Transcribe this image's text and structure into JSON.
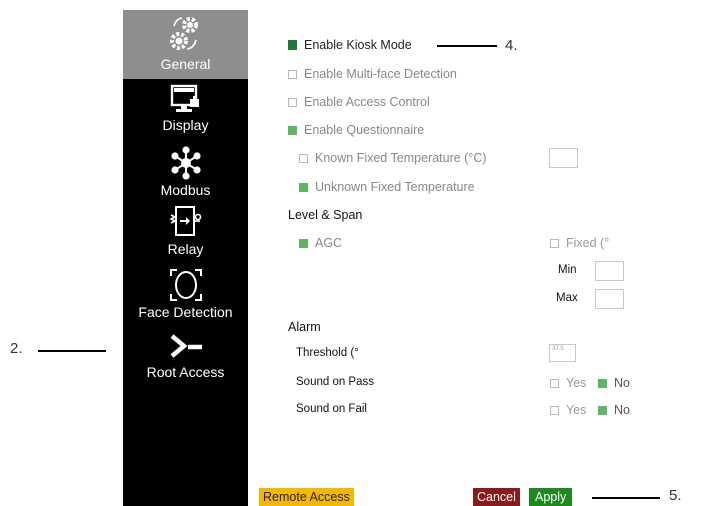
{
  "sidebar": {
    "items": [
      {
        "label": "General",
        "icon": "settings-gears-icon",
        "active": true
      },
      {
        "label": "Display",
        "icon": "display-monitor-icon"
      },
      {
        "label": "Modbus",
        "icon": "network-nodes-icon"
      },
      {
        "label": "Relay",
        "icon": "relay-switch-icon"
      },
      {
        "label": "Face Detection",
        "icon": "face-frame-icon"
      },
      {
        "label": "Root Access",
        "icon": "terminal-prompt-icon"
      }
    ]
  },
  "annotations": {
    "a2": "2.",
    "a4": "4.",
    "a5": "5."
  },
  "settings": {
    "kiosk": "Enable Kiosk Mode",
    "multiface": "Enable Multi-face Detection",
    "access_control": "Enable Access Control",
    "questionnaire": "Enable Questionnaire",
    "known_temp": "Known Fixed Temperature (°C)",
    "unknown_temp": "Unknown Fixed Temperature"
  },
  "level_span": {
    "title": "Level & Span",
    "agc": "AGC",
    "fixed": "Fixed (°",
    "min": "Min",
    "max": "Max"
  },
  "alarm": {
    "title": "Alarm",
    "threshold_label": "Threshold (°",
    "threshold_value": "37.5",
    "sound_pass": "Sound on Pass",
    "sound_fail": "Sound on Fail",
    "yes": "Yes",
    "no": "No"
  },
  "buttons": {
    "remote": "Remote Access",
    "cancel": "Cancel",
    "apply": "Apply"
  },
  "colors": {
    "checked": "#5cb85c",
    "cancel": "#8b1a1a",
    "apply": "#1e8a1e",
    "remote": "#f5b800",
    "active_nav": "#8e8e8e"
  }
}
